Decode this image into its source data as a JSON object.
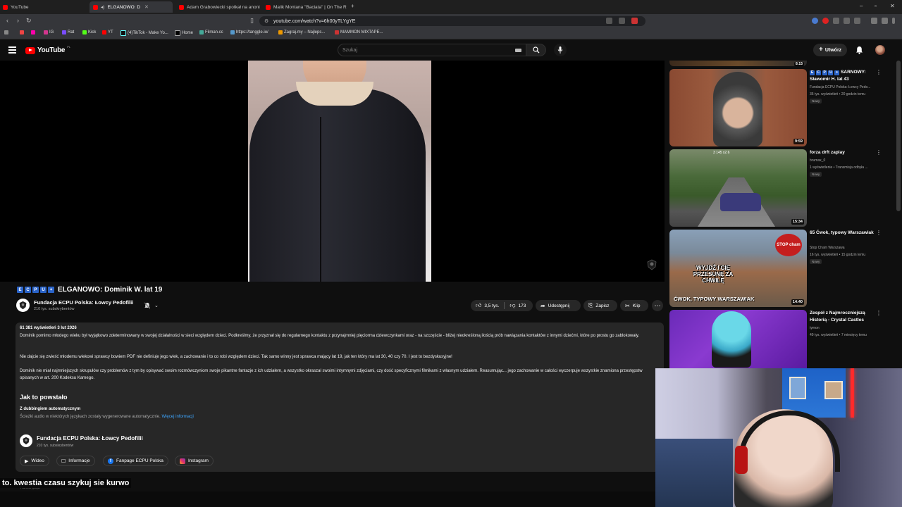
{
  "browser": {
    "tabs": [
      {
        "label": "YouTube",
        "active": false
      },
      {
        "label": "ELGANOWO: D",
        "active": true
      },
      {
        "label": "Adam Grabowiecki spotkał na anoni",
        "active": false
      },
      {
        "label": "Malik Montana \"Baciata\" | On The R",
        "active": false
      }
    ],
    "url": "youtube.com/watch?v=6h00yTLYgYE",
    "bookmarks": [
      "IG",
      "Rat",
      "Kick",
      "YT",
      "(4)TikTok - Make Yo...",
      "Home",
      "Filman.cc",
      "https://tanggle.io/",
      "Zagraj.my – Najleps...",
      "MAMMON MIXTAPE..."
    ]
  },
  "header": {
    "logo_text": "YouTube",
    "logo_country": "PL",
    "search_placeholder": "Szukaj",
    "create_label": "Utwórz"
  },
  "video": {
    "title": "ELGANOWO: Dominik W. lat 19",
    "channel_name": "Fundacja ECPU Polska: Łowcy Pedofilii",
    "subscribers": "210 tys. subskrybentów",
    "likes": "3,5 tys.",
    "dislikes": "173",
    "share_label": "Udostępnij",
    "save_label": "Zapisz",
    "clip_label": "Klip"
  },
  "description": {
    "stats": "61 381 wyświetleń  3 lut 2026",
    "paragraph1": "Dominik pomimo młodego wieku był wyjątkowo zdeterminowany w swojej działalności w sieci względem dzieci. Podkreślmy, że przyznał się do regularnego kontaktu z przynajmniej pięciorma dziewczynkami oraz - na szczęście - bliżej nieokreśloną ilością prób nawiązania kontaktów z innymi dziećmi, które po prostu go zablokowały.",
    "paragraph2": "Nie dajcie się zwieść młodemu wiekowi sprawcy bowiem PDF nie definiuje jego wiek, a zachowanie i to co robi względem dzieci. Tak samo winny jest sprawca mający lat 19, jak ten który ma lat 30, 40 czy 70. I jest to bezdyskusyjne!",
    "paragraph3": "Dominik nie miał najmniejszych skrupułów czy problemów z tym by opisywać swoim rozmówczyniom swoje pikantne fantazje z ich udziałem, a wszystko okraszał swoimi intymnymi zdjęciami, czy dość specyficznymi filmikami z własnym udziałem. Reasumując... jego zachowanie w całości wyczerpuje wszystkie znamiona przestępstw opisanych w art. 200 Kodeksu Karnego.",
    "how_made_heading": "Jak to powstało",
    "dubbing_heading": "Z dubbingiem automatycznym",
    "dubbing_text": "Ścieżki audio w niektórych językach zostały wygenerowane automatycznie.",
    "dubbing_link": "Więcej informacji",
    "channel_name": "Fundacja ECPU Polska: Łowcy Pedofilii",
    "channel_subs": "210 tys. subskrybentów",
    "chips": [
      "Wideo",
      "Informacje",
      "Fanpage ECPU Polska",
      "Instagram"
    ]
  },
  "caption": {
    "text": "to. kwestia czasu szykuj sie kurwo",
    "below": "Transkrypcja"
  },
  "related": [
    {
      "title": "SARNOWY: Sławomir H. lat 43",
      "channel": "Fundacja ECPU Polska: Łowcy Pedo...",
      "meta": "35 tys. wyświetleń • 20 godzin temu",
      "badge": "Nowy",
      "duration": "9:59"
    },
    {
      "title": "forza drft zaplay",
      "channel": "brumax_0",
      "meta": "1 wyświetlenie • Transmisja odbyła ...",
      "badge": "Nowy",
      "duration": "15:34"
    },
    {
      "title": "65 Ćwok, typowy Warszawiak",
      "channel": "Stop Cham Warszawa",
      "meta": "16 tys. wyświetleń • 15 godzin temu",
      "badge": "Nowy",
      "duration": "14:40"
    },
    {
      "title": "Zespół z Najmroczniejszą Historią - Crystal Castles",
      "channel": "tymon",
      "meta": "49 tys. wyświetleń • 7 miesięcy temu",
      "badge": "",
      "duration": ""
    }
  ],
  "related_top_duration": "8:15",
  "thumb_texts": {
    "t3_overlay": "WYJDŹ I CIĘ PRZESUNĘ ZA CHWILĘ",
    "t3_caption": "ĆWOK, TYPOWY WARSZAWIAK",
    "t3_sign": "STOP cham",
    "t2_hud": "3 145 x2.6"
  }
}
